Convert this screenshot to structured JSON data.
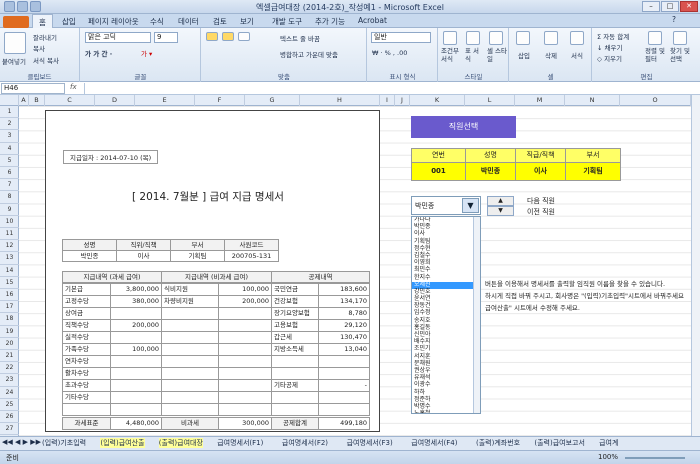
{
  "window": {
    "title": "엑셀급여대장 (2014-2호)_작성예1 - Microsoft Excel"
  },
  "ribbon_tabs": [
    "홈",
    "삽입",
    "페이지 레이아웃",
    "수식",
    "데이터",
    "검토",
    "보기",
    "개발 도구",
    "추가 기능",
    "Acrobat"
  ],
  "ribbon": {
    "paste": "붙여넣기",
    "cut": "잘라내기",
    "copy": "복사",
    "format_painter": "서식 복사",
    "clipboard": "클립보드",
    "font_name": "맑은 고딕",
    "font_size": "9",
    "font_group": "글꼴",
    "wrap_text": "텍스트 줄 바꿈",
    "merge": "병합하고 가운데 맞춤",
    "align_group": "맞춤",
    "number_format": "일반",
    "number_group": "표시 형식",
    "cond_format": "조건부 서식",
    "table_format": "표 서식",
    "cell_style": "셀 스타일",
    "style_group": "스타일",
    "insert": "삽입",
    "delete": "삭제",
    "format": "서식",
    "cells_group": "셀",
    "autosum": "자동 합계",
    "fill": "채우기",
    "clear": "지우기",
    "sort": "정렬 및 필터",
    "find": "찾기 및 선택",
    "edit_group": "편집"
  },
  "formula_bar": {
    "name_box": "H46",
    "fx": "fx",
    "value": ""
  },
  "columns": [
    "A",
    "B",
    "C",
    "D",
    "E",
    "F",
    "G",
    "H",
    "I",
    "J",
    "K",
    "L",
    "M",
    "N",
    "O"
  ],
  "rows": [
    "1",
    "2",
    "3",
    "4",
    "5",
    "6",
    "7",
    "8",
    "9",
    "10",
    "11",
    "12",
    "13",
    "14",
    "15",
    "16",
    "17",
    "18",
    "19",
    "20",
    "21",
    "22",
    "23",
    "24",
    "25",
    "26",
    "27"
  ],
  "statement": {
    "pay_date": "지급일자 : 2014-07-10 (목)",
    "title": "[ 2014. 7월분 ]  급여 지급 명세서",
    "emp_headers": [
      "성명",
      "직위/직책",
      "부서",
      "사원코드"
    ],
    "emp_values": [
      "박민종",
      "이사",
      "기획팀",
      "200705-131"
    ],
    "sec_headers": [
      "지급내역 (과세 급여)",
      "지급내역 (비과세 급여)",
      "공제내역"
    ],
    "rows": [
      [
        "기본급",
        "3,800,000",
        "식비지원",
        "100,000",
        "국민연금",
        "183,600"
      ],
      [
        "고정수당",
        "380,000",
        "차량비지원",
        "200,000",
        "건강보험",
        "134,170"
      ],
      [
        "상여금",
        "",
        "",
        "",
        "장기요양보험",
        "8,780"
      ],
      [
        "직책수당",
        "200,000",
        "",
        "",
        "고용보험",
        "29,120"
      ],
      [
        "실적수당",
        "",
        "",
        "",
        "갑근세",
        "130,470"
      ],
      [
        "가족수당",
        "100,000",
        "",
        "",
        "지방소득세",
        "13,040"
      ],
      [
        "연차수당",
        "",
        "",
        "",
        "",
        ""
      ],
      [
        "활차수당",
        "",
        "",
        "",
        "",
        ""
      ],
      [
        "초과수당",
        "",
        "",
        "",
        "기타공제",
        "-"
      ],
      [
        "기타수당",
        "",
        "",
        "",
        "",
        ""
      ],
      [
        "",
        "",
        "",
        "",
        "",
        ""
      ]
    ],
    "totals": [
      "과세표준",
      "4,480,000",
      "비과세",
      "300,000",
      "공제합계",
      "499,180"
    ]
  },
  "staff_select": {
    "label": "직원선택",
    "headers": [
      "연번",
      "성명",
      "직급/직책",
      "부서"
    ],
    "values": [
      "001",
      "박민종",
      "이사",
      "기획팀"
    ]
  },
  "combo": {
    "value": "박민종"
  },
  "list_items": [
    "가나다",
    "박민종",
    "이사",
    "기획팀",
    "정수현",
    "김철수",
    "이영희",
    "최민수",
    "한지수",
    "오세진",
    "강민호",
    "윤서연",
    "장동건",
    "임수정",
    "송지호",
    "홍길동",
    "신민아",
    "배수지",
    "조민기",
    "서지훈",
    "문채원",
    "권상우",
    "유재석",
    "이광수",
    "하하",
    "정준하",
    "박명수",
    "노홍철"
  ],
  "list_selected_index": 9,
  "nav": {
    "next": "다음 직원",
    "prev": "이전 직원"
  },
  "notes": [
    "버튼을 이용해서 명세서를 출력할 임직원 이름을 찾을 수 있습니다.",
    "하시게 직접 바꿔 주시고, 회사명은 \"(입력)기초입력\"시트에서 바꿔주세요",
    "급여산출\" 시트에서 수정해 주세요."
  ],
  "sheet_tabs": [
    "(입력)기초입력",
    "(입력)급여산출",
    "(출력)급여대장",
    "급여명세서(F1)",
    "급여명세서(F2)",
    "급여명세서(F3)",
    "급여명세서(F4)",
    "(출력)계좌번호",
    "(출력)급여보고서",
    "급여계"
  ],
  "highlighted_tabs": [
    1,
    2
  ],
  "status": {
    "ready": "준비",
    "zoom": "100%"
  }
}
